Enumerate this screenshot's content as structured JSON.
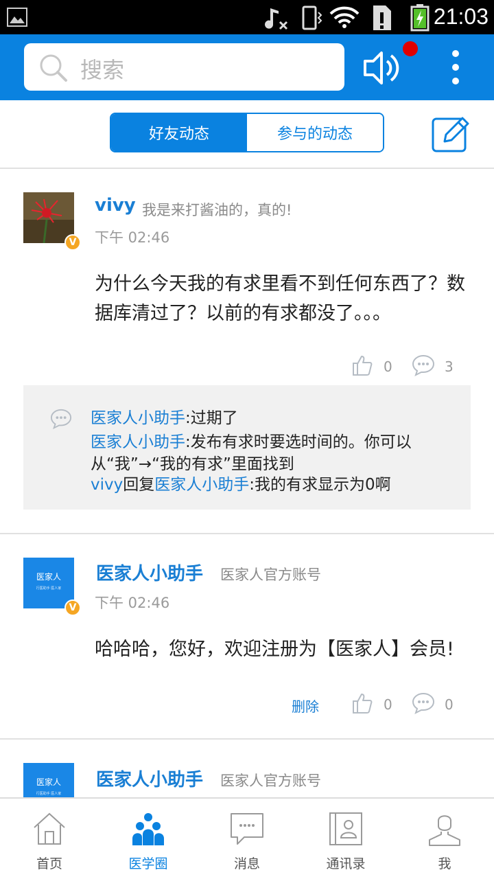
{
  "status_bar": {
    "time": "21:03"
  },
  "header": {
    "search_placeholder": "搜索"
  },
  "tabs": [
    {
      "label": "好友动态"
    },
    {
      "label": "参与的动态"
    }
  ],
  "posts": [
    {
      "name": "vivy",
      "signature": "我是来打酱油的，真的!",
      "time": "下午 02:46",
      "content": "为什么今天我的有求里看不到任何东西了？数据库清过了？以前的有求都没了。。。",
      "likes": "0",
      "comments": "3",
      "comment_list": [
        {
          "author": "医家人小助手",
          "text": ":过期了"
        },
        {
          "author": "医家人小助手",
          "text": ":发布有求时要选时间的。你可以从“我”→“我的有求”里面找到"
        },
        {
          "author": "vivy",
          "reply_word": "回复",
          "reply_to": "医家人小助手",
          "text": ":我的有求显示为0啊"
        }
      ]
    },
    {
      "name": "医家人小助手",
      "signature": "医家人官方账号",
      "avatar_text": "医家人",
      "avatar_subtext": "行医助手 医人家",
      "time": "下午 02:46",
      "content": "哈哈哈，您好，欢迎注册为【医家人】会员!",
      "delete_label": "删除",
      "likes": "0",
      "comments": "0"
    },
    {
      "name": "医家人小助手",
      "signature": "医家人官方账号",
      "avatar_text": "医家人",
      "avatar_subtext": "行医助手 医人家"
    }
  ],
  "badge_letter": "V",
  "bottom_nav": [
    {
      "label": "首页"
    },
    {
      "label": "医学圈"
    },
    {
      "label": "消息"
    },
    {
      "label": "通讯录"
    },
    {
      "label": "我"
    }
  ],
  "colors": {
    "accent": "#0a82e0",
    "link": "#1a7fd4",
    "badge": "#f5a623",
    "notify": "#e00000"
  }
}
